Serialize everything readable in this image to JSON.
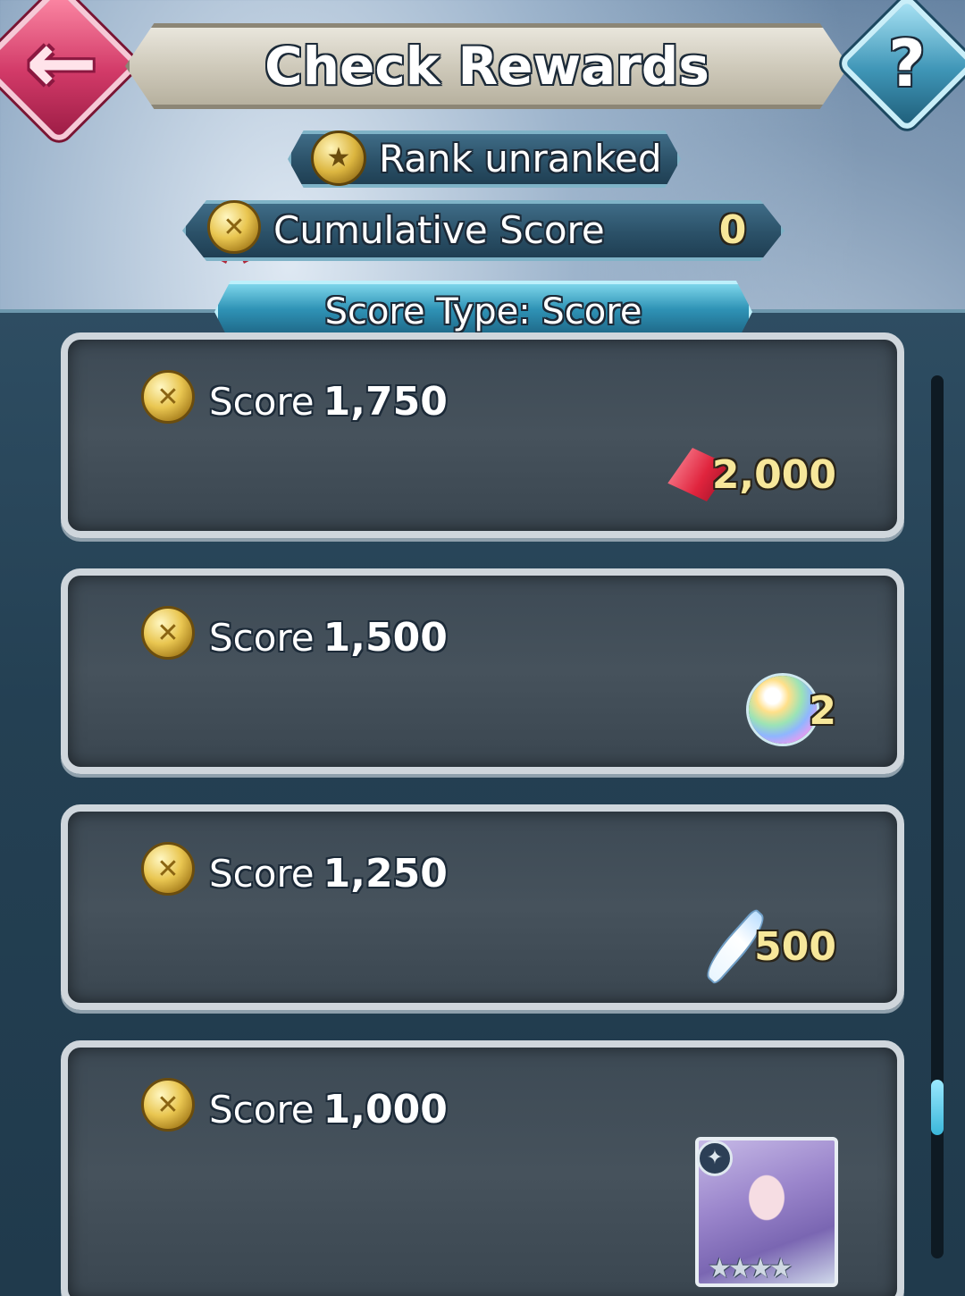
{
  "header": {
    "title": "Check Rewards",
    "help_label": "?"
  },
  "rank": {
    "label": "Rank  unranked"
  },
  "cumulative": {
    "label": "Cumulative Score",
    "value": "0"
  },
  "score_type": {
    "label": "Score Type: Score"
  },
  "rewards": [
    {
      "score_label": "Score",
      "score_value": "1,750",
      "reward_icon": "orb-icon",
      "reward_value": "2,000"
    },
    {
      "score_label": "Score",
      "score_value": "1,500",
      "reward_icon": "divine-dew-sphere-icon",
      "reward_value": "2"
    },
    {
      "score_label": "Score",
      "score_value": "1,250",
      "reward_icon": "feather-icon",
      "reward_value": "500"
    },
    {
      "score_label": "Score",
      "score_value": "1,000",
      "reward_icon": "hero-portrait",
      "reward_value": ""
    }
  ],
  "colors": {
    "accent": "#3fa8cc",
    "gold_text": "#f7e79a",
    "back_button": "#d23a68"
  }
}
